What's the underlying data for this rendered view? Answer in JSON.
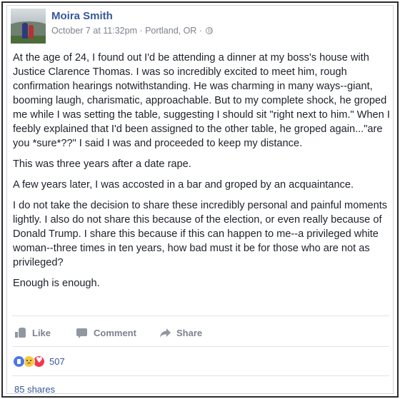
{
  "post": {
    "author": "Moira Smith",
    "meta": "October 7 at 11:32pm · Portland, OR ·",
    "paragraphs": [
      "At the age of 24, I found out I'd be attending a dinner at my boss's house with Justice Clarence Thomas. I was so incredibly excited to meet him, rough confirmation hearings notwithstanding. He was charming in many ways--giant, booming laugh, charismatic, approachable. But to my complete shock, he groped me while I was setting the table, suggesting I should sit \"right next to him.\" When I feebly explained that I'd been assigned to the other table, he groped again...\"are you *sure*??\" I said I was and proceeded to keep my distance.",
      "This was three years after a date rape.",
      "A few years later, I was accosted in a bar and groped by an acquaintance.",
      "I do not take the decision to share these incredibly personal and painful moments lightly. I also do not share this because of the election, or even really because of Donald Trump. I share this because if this can happen to me--a privileged white woman--three times in ten years, how bad must it be for those who are not as privileged?",
      "Enough is enough."
    ]
  },
  "actions": {
    "like": "Like",
    "comment": "Comment",
    "share": "Share"
  },
  "reactions": {
    "icons": [
      "like-reaction-icon",
      "sad-reaction-icon",
      "love-reaction-icon"
    ],
    "count": "507"
  },
  "shares": "85 shares",
  "colors": {
    "link_blue": "#365899",
    "muted_gray": "#7c828c"
  }
}
